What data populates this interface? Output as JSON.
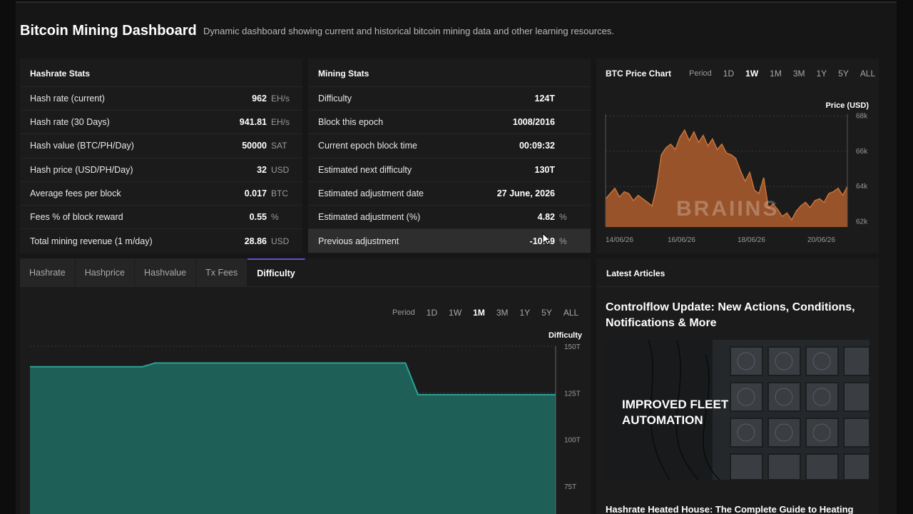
{
  "header": {
    "title": "Bitcoin Mining Dashboard",
    "subtitle": "Dynamic dashboard showing current and historical bitcoin mining data and other learning resources."
  },
  "hashrate_stats": {
    "title": "Hashrate Stats",
    "rows": [
      {
        "label": "Hash rate (current)",
        "value": "962",
        "unit": "EH/s"
      },
      {
        "label": "Hash rate (30 Days)",
        "value": "941.81",
        "unit": "EH/s"
      },
      {
        "label": "Hash value (BTC/PH/Day)",
        "value": "50000",
        "unit": "SAT"
      },
      {
        "label": "Hash price (USD/PH/Day)",
        "value": "32",
        "unit": "USD"
      },
      {
        "label": "Average fees per block",
        "value": "0.017",
        "unit": "BTC"
      },
      {
        "label": "Fees % of block reward",
        "value": "0.55",
        "unit": "%"
      },
      {
        "label": "Total mining revenue (1 m/day)",
        "value": "28.86",
        "unit": "USD"
      }
    ]
  },
  "mining_stats": {
    "title": "Mining Stats",
    "rows": [
      {
        "label": "Difficulty",
        "value": "124T",
        "unit": ""
      },
      {
        "label": "Block this epoch",
        "value": "1008/2016",
        "unit": ""
      },
      {
        "label": "Current epoch block time",
        "value": "00:09:32",
        "unit": ""
      },
      {
        "label": "Estimated next difficulty",
        "value": "130T",
        "unit": ""
      },
      {
        "label": "Estimated adjustment date",
        "value": "27 June, 2026",
        "unit": ""
      },
      {
        "label": "Estimated adjustment (%)",
        "value": "4.82",
        "unit": "%"
      },
      {
        "label": "Previous adjustment",
        "value": "-10.09",
        "unit": "%"
      }
    ]
  },
  "price_chart": {
    "title": "BTC Price Chart",
    "period_label": "Period",
    "periods": [
      "1D",
      "1W",
      "1M",
      "3M",
      "1Y",
      "5Y",
      "ALL"
    ],
    "active_period": "1W",
    "watermark": "BRAIINS",
    "colors": {
      "fill": "#a65a2c",
      "line": "#c8743c"
    }
  },
  "difficulty_panel": {
    "tabs": [
      "Hashrate",
      "Hashprice",
      "Hashvalue",
      "Tx Fees",
      "Difficulty"
    ],
    "active_tab": "Difficulty",
    "period_label": "Period",
    "periods": [
      "1D",
      "1W",
      "1M",
      "3M",
      "1Y",
      "5Y",
      "ALL"
    ],
    "active_period": "1M",
    "colors": {
      "fill": "#1e5f58",
      "line": "#2aa395"
    }
  },
  "articles": {
    "title": "Latest Articles",
    "items": [
      {
        "title": "Controlflow Update: New Actions, Conditions, Notifications & More",
        "image_caption": "IMPROVED FLEET AUTOMATION"
      },
      {
        "title": "Hashrate Heated House: The Complete Guide to Heating"
      }
    ]
  },
  "chart_data": [
    {
      "type": "area",
      "title": "BTC Price Chart",
      "ylabel": "Price (USD)",
      "ylim": [
        61700,
        68100
      ],
      "y_ticks": [
        "62k",
        "64k",
        "66k",
        "68k"
      ],
      "x_ticks": [
        "14/06/26",
        "16/06/26",
        "18/06/26",
        "20/06/26"
      ],
      "series": [
        {
          "values": [
            63300,
            63600,
            63900,
            63400,
            63700,
            63600,
            63200,
            63500,
            63300,
            63100,
            62900,
            64000,
            65800,
            66200,
            66400,
            66100,
            66800,
            67200,
            66600,
            67100,
            66500,
            66900,
            66300,
            66700,
            66100,
            66400,
            65900,
            65800,
            65600,
            64900,
            64300,
            64800,
            63800,
            63600,
            64500,
            62800,
            63000,
            62700,
            62300,
            62500,
            62100,
            62600,
            62900,
            63100,
            62800,
            63200,
            63300,
            63100,
            63600,
            63700,
            63900,
            63500,
            64000
          ]
        }
      ]
    },
    {
      "type": "area",
      "title": "Difficulty",
      "ylabel": "Difficulty",
      "ylim": [
        60,
        150
      ],
      "y_ticks": [
        "75T",
        "100T",
        "125T",
        "150T"
      ],
      "series": [
        {
          "values": [
            139,
            139,
            139,
            139,
            139,
            139,
            139,
            139,
            139,
            139,
            141,
            141,
            141,
            141,
            141,
            141,
            141,
            141,
            141,
            141,
            141,
            141,
            141,
            141,
            141,
            141,
            141,
            141,
            141,
            141,
            141,
            124,
            124,
            124,
            124,
            124,
            124,
            124,
            124,
            124,
            124,
            124,
            124
          ]
        }
      ]
    }
  ]
}
